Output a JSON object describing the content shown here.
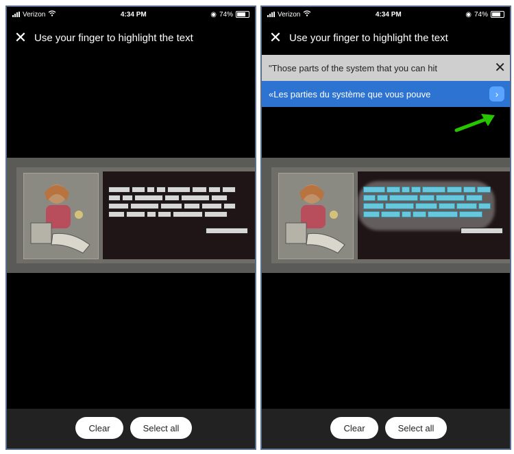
{
  "screens": [
    {
      "status": {
        "carrier": "Verizon",
        "time": "4:34 PM",
        "battery": "74%"
      },
      "header": {
        "title": "Use your finger to highlight the text"
      },
      "actions": {
        "clear": "Clear",
        "select_all": "Select all"
      }
    },
    {
      "status": {
        "carrier": "Verizon",
        "time": "4:34 PM",
        "battery": "74%"
      },
      "header": {
        "title": "Use your finger to highlight the text"
      },
      "translation": {
        "source": "\"Those parts of the system that you can hit",
        "target": "«Les parties du système que vous pouve"
      },
      "actions": {
        "clear": "Clear",
        "select_all": "Select all"
      }
    }
  ],
  "colors": {
    "accent": "#2d73d2",
    "highlight": "#67c7dd",
    "annotation_arrow": "#27c400"
  },
  "icons": [
    "close-icon",
    "wifi-icon",
    "battery-icon",
    "arrow-right-icon"
  ]
}
